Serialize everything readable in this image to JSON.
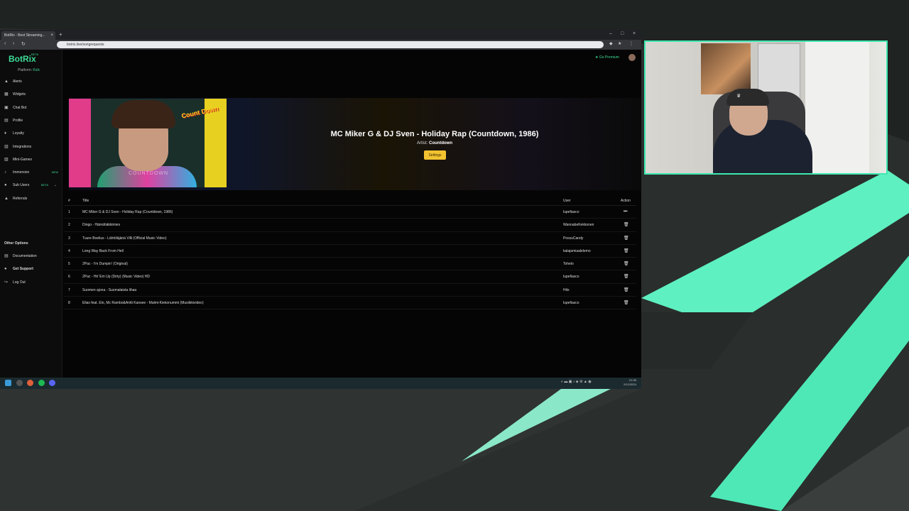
{
  "browser": {
    "tab_title": "BotRix - Best Streaming...",
    "tab_close": "×",
    "new_tab": "+",
    "url": "botrix.live/songrequests",
    "window_controls": [
      "–",
      "□",
      "×"
    ]
  },
  "app": {
    "brand": "BotRix",
    "brand_badge": "BETA",
    "platform_label": "Platform:",
    "platform_value": "Kick",
    "go_premium": "★ Go Premium",
    "nav": [
      {
        "label": "Alerts",
        "icon": "bell-icon",
        "glyph": "▲"
      },
      {
        "label": "Widgets",
        "icon": "widgets-icon",
        "glyph": "▦"
      },
      {
        "label": "Chat Bot",
        "icon": "chatbot-icon",
        "glyph": "▣"
      },
      {
        "label": "Profile",
        "icon": "profile-icon",
        "glyph": "▤"
      },
      {
        "label": "Loyalty",
        "icon": "loyalty-icon",
        "glyph": "♦"
      },
      {
        "label": "Integrations",
        "icon": "integrations-icon",
        "glyph": "▥"
      },
      {
        "label": "Mini-Games",
        "icon": "games-icon",
        "glyph": "▧"
      },
      {
        "label": "Immersion",
        "icon": "music-icon",
        "glyph": "♪",
        "badge": "NEW"
      },
      {
        "label": "Sub Users",
        "icon": "subusers-icon",
        "glyph": "●",
        "badge": "BETA",
        "expand": "⌄"
      },
      {
        "label": "Referrals",
        "icon": "referrals-icon",
        "glyph": "▲"
      }
    ],
    "other_options_title": "Other Options",
    "other_nav": [
      {
        "label": "Documentation",
        "icon": "doc-icon",
        "glyph": "▤"
      },
      {
        "label": "Get Support",
        "icon": "support-icon",
        "glyph": "●"
      },
      {
        "label": "Log Out",
        "icon": "logout-icon",
        "glyph": "↪"
      }
    ]
  },
  "now_playing": {
    "title": "MC Miker G & DJ Sven - Holiday Rap (Countdown, 1986)",
    "artist_label": "Artist:",
    "artist": "Countdown",
    "settings_button": "Settings",
    "thumbnail_logo": "Count Down",
    "thumbnail_watermark": "COUNTDOWN"
  },
  "queue": {
    "headers": {
      "num": "#",
      "title": "Title",
      "user": "User",
      "action": "Action"
    },
    "rows": [
      {
        "num": "1",
        "title": "MC Miker G & DJ Sven - Holiday Rap (Countdown, 1986)",
        "user": "lupefiasco",
        "action": "⏭"
      },
      {
        "num": "2",
        "title": "Dingo - Hämähäkkimies",
        "user": "WannabeKekkonen",
        "action": "🗑"
      },
      {
        "num": "3",
        "title": "Tuure Boelius - Lähtöläjänä Villi (Official Music Video)",
        "user": "PossuCandy",
        "action": "🗑"
      },
      {
        "num": "4",
        "title": "Long Way Back From Hell",
        "user": "kalajamiaalelemo",
        "action": "🗑"
      },
      {
        "num": "5",
        "title": "2Pac - I'm Dumpin' (Original)",
        "user": "Tohelo",
        "action": "🗑"
      },
      {
        "num": "6",
        "title": "2Pac - Hit 'Em Up (Dirty) (Music Video) HD",
        "user": "lupefiasco",
        "action": "🗑"
      },
      {
        "num": "7",
        "title": "Suomen ajona - Suomalaista lihaa",
        "user": "Hitx",
        "action": "🗑"
      },
      {
        "num": "8",
        "title": "Elias feat. Elo, Mc Rambo&Antti Kansee - Malmi-Kiekonummi (Musiikkivideo)",
        "user": "lupefiasco",
        "action": "🗑"
      }
    ]
  },
  "taskbar": {
    "clock_time": "21:36",
    "clock_date": "2/12/2024"
  },
  "colors": {
    "accent": "#3ddc97",
    "settings_button": "#f2c230",
    "webcam_border": "#3de8b0"
  }
}
